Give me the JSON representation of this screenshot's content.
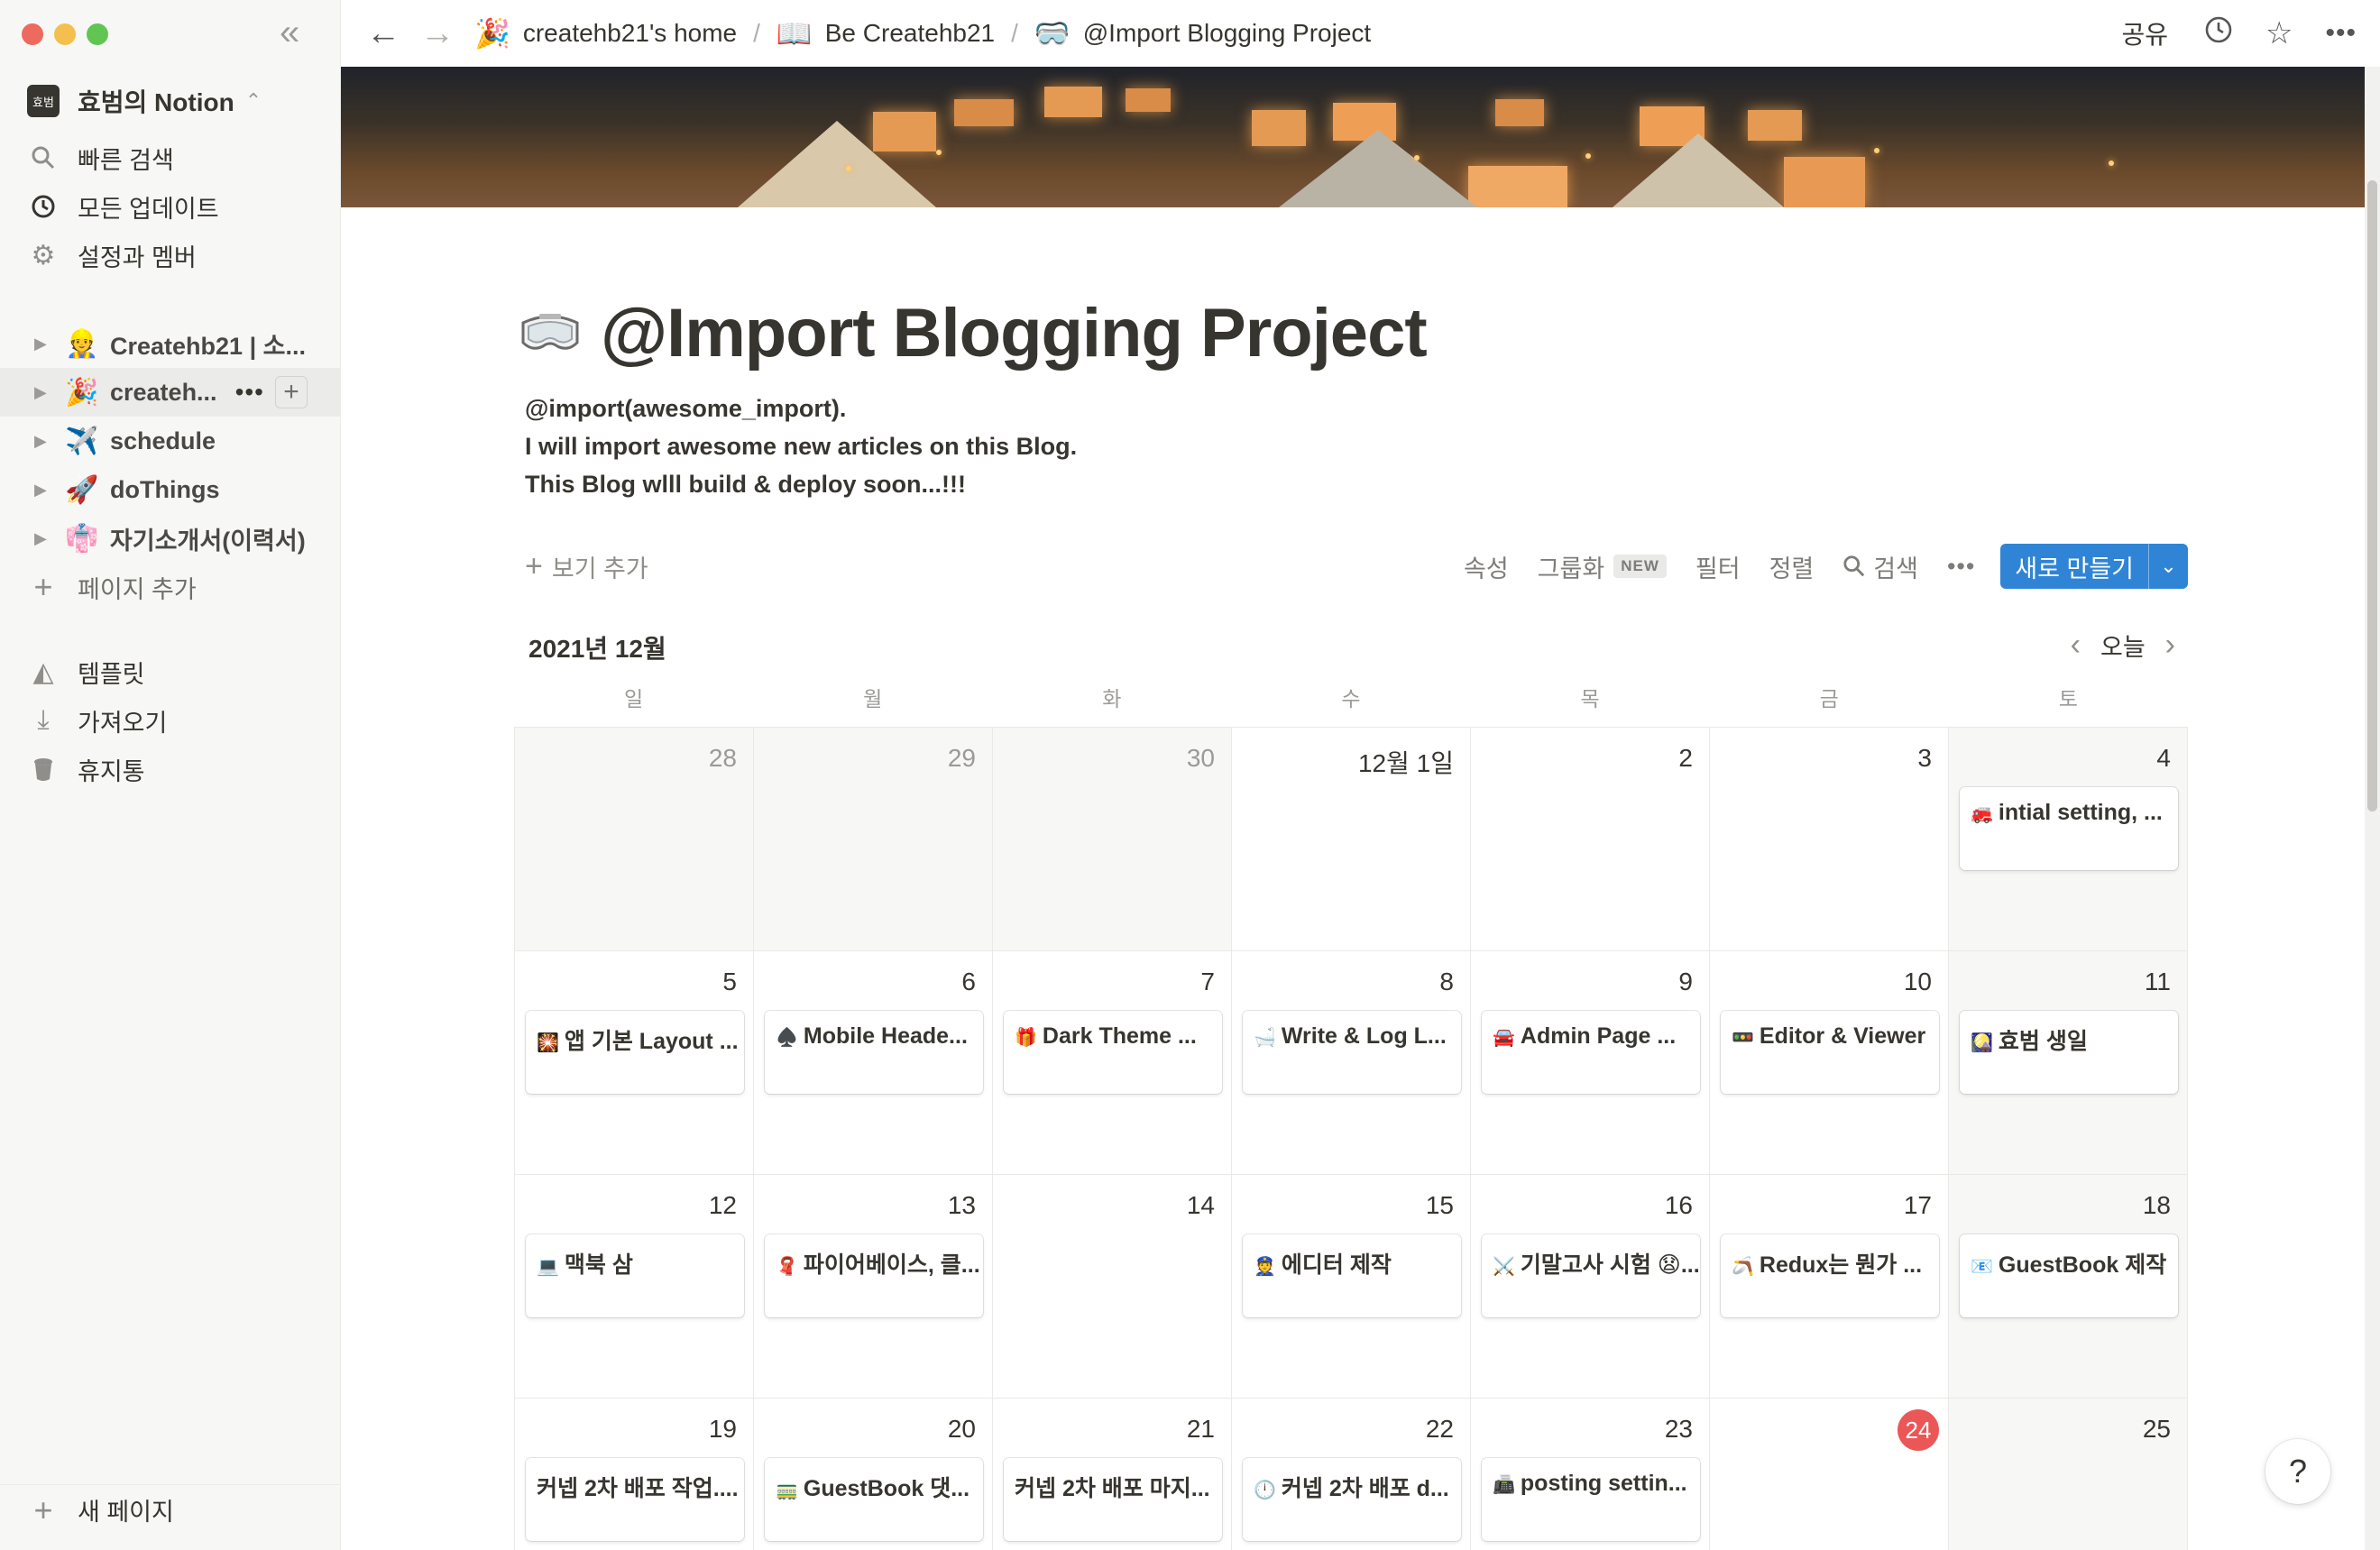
{
  "sidebar": {
    "workspace": {
      "avatar_text": "효범",
      "name": "효범의 Notion"
    },
    "nav": [
      {
        "label": "빠른 검색",
        "icon": "search-icon"
      },
      {
        "label": "모든 업데이트",
        "icon": "clock-icon"
      },
      {
        "label": "설정과 멤버",
        "icon": "gear-icon"
      }
    ],
    "pages": [
      {
        "emoji": "👷",
        "label": "Createhb21 | 소..."
      },
      {
        "emoji": "🎉",
        "label": "createh..."
      },
      {
        "emoji": "✈️",
        "label": "schedule"
      },
      {
        "emoji": "🚀",
        "label": "doThings"
      },
      {
        "emoji": "👘",
        "label": "자기소개서(이력서)"
      }
    ],
    "add_page": "페이지 추가",
    "tools": [
      {
        "label": "템플릿",
        "icon": "shapes-icon"
      },
      {
        "label": "가져오기",
        "icon": "download-icon"
      },
      {
        "label": "휴지통",
        "icon": "trash-icon"
      }
    ],
    "new_page": "새 페이지"
  },
  "topbar": {
    "breadcrumbs": [
      {
        "emoji": "🎉",
        "label": "createhb21's home"
      },
      {
        "emoji": "📖",
        "label": "Be Createhb21"
      },
      {
        "emoji": "🥽",
        "label": "@Import Blogging Project"
      }
    ],
    "share": "공유"
  },
  "page": {
    "title": "@Import Blogging Project",
    "description": [
      "@import(awesome_import).",
      "I will import awesome new articles on this Blog.",
      "This Blog wlll build & deploy soon...!!!"
    ]
  },
  "toolbar": {
    "add_view": "보기 추가",
    "properties": "속성",
    "group": "그룹화",
    "new_badge": "NEW",
    "filter": "필터",
    "sort": "정렬",
    "search": "검색",
    "new_button": "새로 만들기"
  },
  "calendar": {
    "month": "2021년 12월",
    "today_label": "오늘",
    "weekdays": [
      "일",
      "월",
      "화",
      "수",
      "목",
      "금",
      "토"
    ],
    "weeks": [
      [
        {
          "day": "28",
          "other": true
        },
        {
          "day": "29",
          "other": true
        },
        {
          "day": "30",
          "other": true
        },
        {
          "day": "12월 1일"
        },
        {
          "day": "2"
        },
        {
          "day": "3"
        },
        {
          "day": "4",
          "card": {
            "emoji": "🚒",
            "text": "intial setting, ..."
          }
        }
      ],
      [
        {
          "day": "5",
          "card": {
            "emoji": "🎇",
            "text": "앱 기본 Layout ..."
          }
        },
        {
          "day": "6",
          "card": {
            "emoji": "♠️",
            "text": "Mobile Heade..."
          }
        },
        {
          "day": "7",
          "card": {
            "emoji": "🎁",
            "text": "Dark Theme ..."
          }
        },
        {
          "day": "8",
          "card": {
            "emoji": "🛁",
            "text": "Write & Log L..."
          }
        },
        {
          "day": "9",
          "card": {
            "emoji": "🚘",
            "text": "Admin Page ..."
          }
        },
        {
          "day": "10",
          "card": {
            "emoji": "🚥",
            "text": "Editor & Viewer"
          }
        },
        {
          "day": "11",
          "card": {
            "emoji": "🎑",
            "text": "효범 생일"
          }
        }
      ],
      [
        {
          "day": "12",
          "card": {
            "emoji": "💻",
            "text": "맥북 삼"
          }
        },
        {
          "day": "13",
          "card": {
            "emoji": "🧣",
            "text": "파이어베이스, 클..."
          }
        },
        {
          "day": "14"
        },
        {
          "day": "15",
          "card": {
            "emoji": "👮",
            "text": "에디터 제작"
          }
        },
        {
          "day": "16",
          "card": {
            "emoji": "⚔️",
            "text": "기말고사 시험 😧..."
          }
        },
        {
          "day": "17",
          "card": {
            "emoji": "🪃",
            "text": "Redux는 뭔가 ..."
          }
        },
        {
          "day": "18",
          "card": {
            "emoji": "📧",
            "text": "GuestBook 제작"
          }
        }
      ],
      [
        {
          "day": "19",
          "card": {
            "emoji": "",
            "text": "커넵 2차 배포 작업...."
          }
        },
        {
          "day": "20",
          "card": {
            "emoji": "🚃",
            "text": "GuestBook 댓..."
          }
        },
        {
          "day": "21",
          "card": {
            "emoji": "",
            "text": "커넵 2차 배포 마지..."
          }
        },
        {
          "day": "22",
          "card": {
            "emoji": "🕛",
            "text": "커넵 2차 배포 d..."
          }
        },
        {
          "day": "23",
          "card": {
            "emoji": "📠",
            "text": "posting settin..."
          }
        },
        {
          "day": "24",
          "today": true
        },
        {
          "day": "25"
        }
      ]
    ]
  },
  "help": "?",
  "colors": {
    "accent": "#2f84d6",
    "today": "#eb5757",
    "sidebar_bg": "#f7f7f5"
  }
}
